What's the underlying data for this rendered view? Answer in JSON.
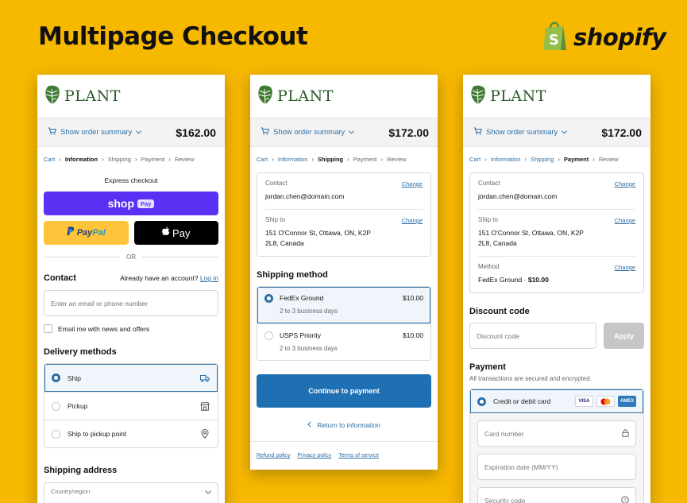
{
  "headline": "Multipage Checkout",
  "brand": {
    "name": "shopify",
    "icon": "shopify-bag-icon",
    "color": "#95bf47"
  },
  "colors": {
    "background": "#f7b800",
    "accent": "#2b6ea6",
    "primary_button": "#1f6fb3",
    "shop_pay": "#5a31f4",
    "paypal": "#ffc439"
  },
  "store": {
    "name": "PLANT",
    "icon": "monstera-leaf-icon"
  },
  "panel1": {
    "summary_label": "Show order summary",
    "total": "$162.00",
    "breadcrumbs": [
      "Cart",
      "Information",
      "Shipping",
      "Payment",
      "Review"
    ],
    "express_label": "Express checkout",
    "shop_pay": {
      "word": "shop",
      "badge": "Pay"
    },
    "paypal": {
      "pay": "Pay",
      "pal": "Pal"
    },
    "apple_pay": "Pay",
    "or_label": "OR",
    "contact": {
      "title": "Contact",
      "account_prompt": "Already have an account?",
      "login_label": "Log in",
      "placeholder": "Enter an email or phone number",
      "newsletter_label": "Email me with news and offers"
    },
    "delivery": {
      "title": "Delivery methods",
      "options": [
        {
          "label": "Ship",
          "icon": "truck-icon",
          "selected": true
        },
        {
          "label": "Pickup",
          "icon": "store-icon",
          "selected": false
        },
        {
          "label": "Ship to pickup point",
          "icon": "location-pin-icon",
          "selected": false
        }
      ]
    },
    "shipping_address": {
      "title": "Shipping address",
      "country_placeholder": "Country/region"
    }
  },
  "panel2": {
    "summary_label": "Show order summary",
    "total": "$172.00",
    "breadcrumbs": [
      "Cart",
      "Information",
      "Shipping",
      "Payment",
      "Review"
    ],
    "contact_label": "Contact",
    "contact_value": "jordan.chen@domain.com",
    "ship_to_label": "Ship to",
    "ship_to_value": "151 O'Connor St, Ottawa, ON, K2P 2L8, Canada",
    "change_label": "Change",
    "shipping_title": "Shipping method",
    "methods": [
      {
        "name": "FedEx Ground",
        "price": "$10.00",
        "eta": "2 to 3 business days",
        "selected": true
      },
      {
        "name": "USPS Priority",
        "price": "$10.00",
        "eta": "2 to 3 business days",
        "selected": false
      }
    ],
    "continue_label": "Continue to payment",
    "return_label": "Return to information",
    "policies": [
      "Refund policy",
      "Privacy policy",
      "Terms of service"
    ]
  },
  "panel3": {
    "summary_label": "Show order summary",
    "total": "$172.00",
    "breadcrumbs": [
      "Cart",
      "Information",
      "Shipping",
      "Payment",
      "Review"
    ],
    "contact_label": "Contact",
    "contact_value": "jordan.chen@domain.com",
    "ship_to_label": "Ship to",
    "ship_to_value": "151 O'Connor St, Ottawa, ON, K2P 2L8, Canada",
    "method_label": "Method",
    "method_value": "FedEx Ground",
    "method_price": "$10.00",
    "method_sep": " · ",
    "change_label": "Change",
    "discount_title": "Discount code",
    "discount_placeholder": "Discount code",
    "apply_label": "Apply",
    "payment_title": "Payment",
    "payment_note": "All transactions are secured and encrypted.",
    "card_label": "Credit or debit card",
    "card_brands": {
      "visa": "VISA",
      "mastercard": "mastercard-icon",
      "amex": "AMEX"
    },
    "card_number_placeholder": "Card number",
    "expiry_placeholder": "Expiration date (MM/YY)",
    "security_placeholder": "Security code"
  }
}
